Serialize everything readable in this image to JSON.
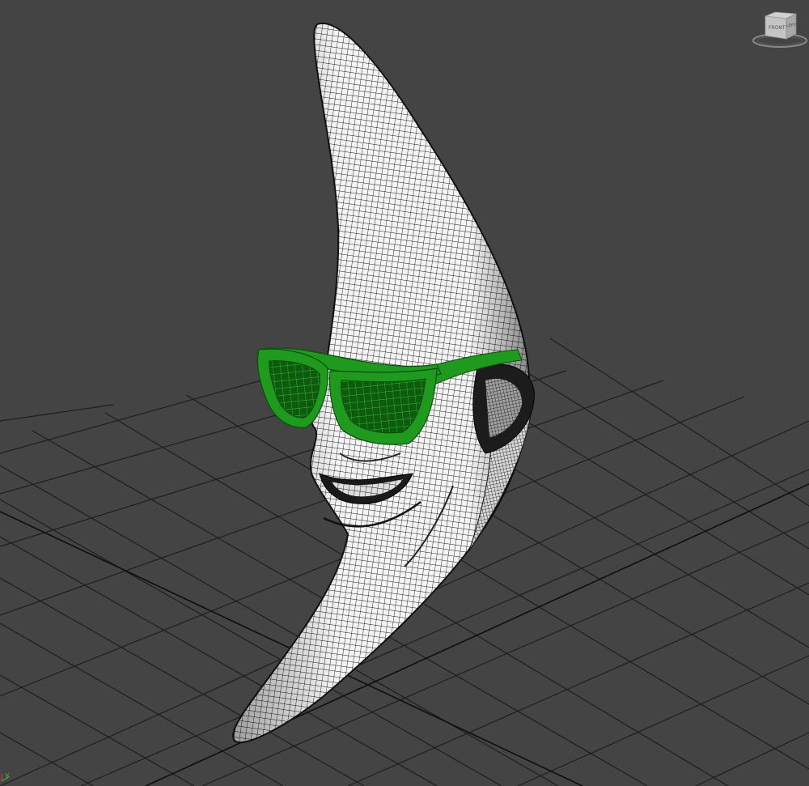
{
  "viewport": {
    "background": "#444444",
    "grid_color": "#1e1e1e",
    "viewcube": {
      "faces": [
        "FRONT",
        "LEFT"
      ]
    },
    "axis_indicator": {
      "label": "Y"
    }
  },
  "model": {
    "object": "crescent-moon-head",
    "display": "wireframe-on-shaded",
    "surface_color": "#f2f2f2",
    "wire_color": "#111111",
    "accessory": {
      "object": "sunglasses",
      "color": "#1f9a1f"
    }
  }
}
